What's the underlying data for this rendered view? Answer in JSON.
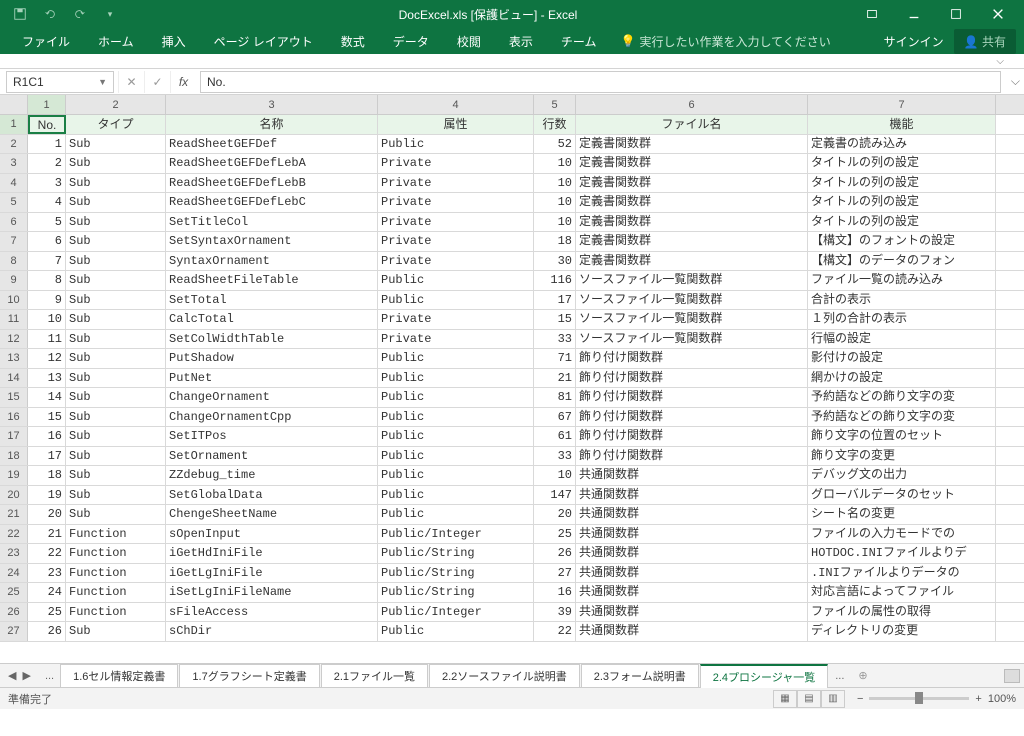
{
  "title": "DocExcel.xls [保護ビュー] - Excel",
  "qat": {
    "save": "save-icon",
    "undo": "undo-icon",
    "redo": "redo-icon"
  },
  "ribbon": {
    "file": "ファイル",
    "home": "ホーム",
    "insert": "挿入",
    "layout": "ページ レイアウト",
    "formulas": "数式",
    "data": "データ",
    "review": "校閲",
    "view": "表示",
    "team": "チーム",
    "tell": "実行したい作業を入力してください",
    "signin": "サインイン",
    "share": "共有"
  },
  "namebox": "R1C1",
  "fxvalue": "No.",
  "cols": [
    "1",
    "2",
    "3",
    "4",
    "5",
    "6",
    "7"
  ],
  "headers": [
    "No.",
    "タイプ",
    "名称",
    "属性",
    "行数",
    "ファイル名",
    "機能"
  ],
  "rows": [
    {
      "n": "1",
      "t": "Sub",
      "name": "ReadSheetGEFDef",
      "attr": "Public",
      "lines": "52",
      "file": "定義書関数群",
      "func": "定義書の読み込み"
    },
    {
      "n": "2",
      "t": "Sub",
      "name": "ReadSheetGEFDefLebA",
      "attr": "Private",
      "lines": "10",
      "file": "定義書関数群",
      "func": "タイトルの列の設定"
    },
    {
      "n": "3",
      "t": "Sub",
      "name": "ReadSheetGEFDefLebB",
      "attr": "Private",
      "lines": "10",
      "file": "定義書関数群",
      "func": "タイトルの列の設定"
    },
    {
      "n": "4",
      "t": "Sub",
      "name": "ReadSheetGEFDefLebC",
      "attr": "Private",
      "lines": "10",
      "file": "定義書関数群",
      "func": "タイトルの列の設定"
    },
    {
      "n": "5",
      "t": "Sub",
      "name": "SetTitleCol",
      "attr": "Private",
      "lines": "10",
      "file": "定義書関数群",
      "func": "タイトルの列の設定"
    },
    {
      "n": "6",
      "t": "Sub",
      "name": "SetSyntaxOrnament",
      "attr": "Private",
      "lines": "18",
      "file": "定義書関数群",
      "func": "【構文】のフォントの設定"
    },
    {
      "n": "7",
      "t": "Sub",
      "name": "SyntaxOrnament",
      "attr": "Private",
      "lines": "30",
      "file": "定義書関数群",
      "func": "【構文】のデータのフォン"
    },
    {
      "n": "8",
      "t": "Sub",
      "name": "ReadSheetFileTable",
      "attr": "Public",
      "lines": "116",
      "file": "ソースファイル一覧関数群",
      "func": "ファイル一覧の読み込み"
    },
    {
      "n": "9",
      "t": "Sub",
      "name": "SetTotal",
      "attr": "Public",
      "lines": "17",
      "file": "ソースファイル一覧関数群",
      "func": "合計の表示"
    },
    {
      "n": "10",
      "t": "Sub",
      "name": "CalcTotal",
      "attr": "Private",
      "lines": "15",
      "file": "ソースファイル一覧関数群",
      "func": "１列の合計の表示"
    },
    {
      "n": "11",
      "t": "Sub",
      "name": "SetColWidthTable",
      "attr": "Private",
      "lines": "33",
      "file": "ソースファイル一覧関数群",
      "func": "行幅の設定"
    },
    {
      "n": "12",
      "t": "Sub",
      "name": "PutShadow",
      "attr": "Public",
      "lines": "71",
      "file": "飾り付け関数群",
      "func": "影付けの設定"
    },
    {
      "n": "13",
      "t": "Sub",
      "name": "PutNet",
      "attr": "Public",
      "lines": "21",
      "file": "飾り付け関数群",
      "func": "網かけの設定"
    },
    {
      "n": "14",
      "t": "Sub",
      "name": "ChangeOrnament",
      "attr": "Public",
      "lines": "81",
      "file": "飾り付け関数群",
      "func": "予約語などの飾り文字の変"
    },
    {
      "n": "15",
      "t": "Sub",
      "name": "ChangeOrnamentCpp",
      "attr": "Public",
      "lines": "67",
      "file": "飾り付け関数群",
      "func": "予約語などの飾り文字の変"
    },
    {
      "n": "16",
      "t": "Sub",
      "name": "SetITPos",
      "attr": "Public",
      "lines": "61",
      "file": "飾り付け関数群",
      "func": "飾り文字の位置のセット"
    },
    {
      "n": "17",
      "t": "Sub",
      "name": "SetOrnament",
      "attr": "Public",
      "lines": "33",
      "file": "飾り付け関数群",
      "func": "飾り文字の変更"
    },
    {
      "n": "18",
      "t": "Sub",
      "name": "ZZdebug_time",
      "attr": "Public",
      "lines": "10",
      "file": "共通関数群",
      "func": "デバッグ文の出力"
    },
    {
      "n": "19",
      "t": "Sub",
      "name": "SetGlobalData",
      "attr": "Public",
      "lines": "147",
      "file": "共通関数群",
      "func": "グローバルデータのセット"
    },
    {
      "n": "20",
      "t": "Sub",
      "name": "ChengeSheetName",
      "attr": "Public",
      "lines": "20",
      "file": "共通関数群",
      "func": "シート名の変更"
    },
    {
      "n": "21",
      "t": "Function",
      "name": "sOpenInput",
      "attr": "Public/Integer",
      "lines": "25",
      "file": "共通関数群",
      "func": "ファイルの入力モードでの"
    },
    {
      "n": "22",
      "t": "Function",
      "name": "iGetHdIniFile",
      "attr": "Public/String",
      "lines": "26",
      "file": "共通関数群",
      "func": "HOTDOC.INIファイルよりデ"
    },
    {
      "n": "23",
      "t": "Function",
      "name": "iGetLgIniFile",
      "attr": "Public/String",
      "lines": "27",
      "file": "共通関数群",
      "func": ".INIファイルよりデータの"
    },
    {
      "n": "24",
      "t": "Function",
      "name": "iSetLgIniFileName",
      "attr": "Public/String",
      "lines": "16",
      "file": "共通関数群",
      "func": "対応言語によってファイル"
    },
    {
      "n": "25",
      "t": "Function",
      "name": "sFileAccess",
      "attr": "Public/Integer",
      "lines": "39",
      "file": "共通関数群",
      "func": "ファイルの属性の取得"
    },
    {
      "n": "26",
      "t": "Sub",
      "name": "sChDir",
      "attr": "Public",
      "lines": "22",
      "file": "共通関数群",
      "func": "ディレクトリの変更"
    }
  ],
  "sheets": {
    "s1": "1.6セル情報定義書",
    "s2": "1.7グラフシート定義書",
    "s3": "2.1ファイル一覧",
    "s4": "2.2ソースファイル説明書",
    "s5": "2.3フォーム説明書",
    "s6": "2.4プロシージャ一覧"
  },
  "status": {
    "ready": "準備完了",
    "zoom": "100%"
  }
}
